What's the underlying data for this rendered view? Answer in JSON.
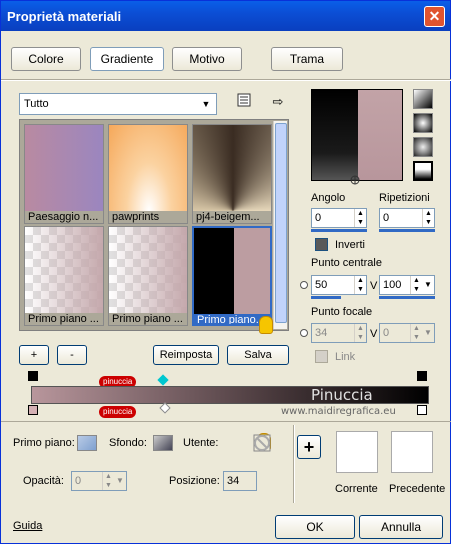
{
  "window": {
    "title": "Proprietà materiali",
    "close_glyph": "✕"
  },
  "tabs": [
    {
      "label": "Colore"
    },
    {
      "label": "Gradiente"
    },
    {
      "label": "Motivo"
    },
    {
      "label": "Trama"
    }
  ],
  "category": {
    "selected": "Tutto"
  },
  "gallery": {
    "items": [
      {
        "caption": "Paesaggio n..."
      },
      {
        "caption": "pawprints"
      },
      {
        "caption": "pj4-beigem..."
      },
      {
        "caption": "Primo piano ..."
      },
      {
        "caption": "Primo piano ..."
      },
      {
        "caption": "Primo piano..."
      }
    ]
  },
  "gallery_buttons": {
    "add": "+",
    "remove": "-",
    "reset": "Reimposta",
    "save": "Salva"
  },
  "angle": {
    "label": "Angolo",
    "value": "0"
  },
  "repeats": {
    "label": "Ripetizioni",
    "value": "0"
  },
  "invert": {
    "label": "Inverti"
  },
  "center_point": {
    "label": "Punto centrale",
    "x": "50",
    "y": "100",
    "v_label": "V"
  },
  "focal_point": {
    "label": "Punto focale",
    "x": "34",
    "y": "0",
    "v_label": "V"
  },
  "link": {
    "label": "Link"
  },
  "watermark": {
    "brand": "Pinuccia",
    "url": "www.maidiregrafica.eu",
    "tag": "pinuccia"
  },
  "bottom": {
    "foreground_label": "Primo piano:",
    "background_label": "Sfondo:",
    "user_label": "Utente:",
    "opacity_label": "Opacità:",
    "opacity_value": "0",
    "position_label": "Posizione:",
    "position_value": "34",
    "add_glyph": "+",
    "current_label": "Corrente",
    "previous_label": "Precedente"
  },
  "footer": {
    "help": "Guida",
    "ok": "OK",
    "cancel": "Annulla"
  },
  "colors": {
    "accent": "#316ac5",
    "title_bar": "#0b4ed5",
    "gradient_start": "#b8969c",
    "gradient_end": "#000000"
  }
}
